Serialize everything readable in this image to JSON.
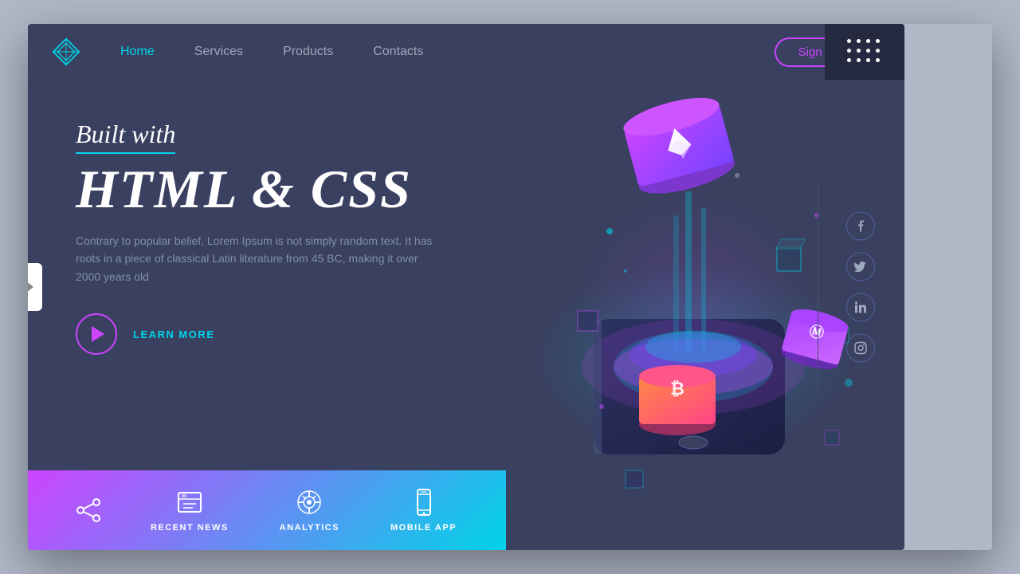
{
  "brand": {
    "logo_label": "logo-diamond"
  },
  "navbar": {
    "links": [
      {
        "label": "Home",
        "active": true
      },
      {
        "label": "Services",
        "active": false
      },
      {
        "label": "Products",
        "active": false
      },
      {
        "label": "Contacts",
        "active": false
      }
    ],
    "cta_label": "Sign Up"
  },
  "hero": {
    "subtitle": "Built with",
    "title": "HTML & CSS",
    "body": "Contrary to popular belief, Lorem Ipsum is not simply random text. It has roots in a piece of classical Latin literature from 45 BC, making it over 2000 years old",
    "cta_label": "LEARN MORE"
  },
  "bottom_bar": {
    "items": [
      {
        "label": "RECENT NEWS",
        "icon": "news-icon"
      },
      {
        "label": "ANALYTICS",
        "icon": "analytics-icon"
      },
      {
        "label": "MOBILE APP",
        "icon": "mobile-icon"
      }
    ]
  },
  "social": {
    "icons": [
      {
        "label": "facebook-icon",
        "symbol": "f"
      },
      {
        "label": "twitter-icon",
        "symbol": "t"
      },
      {
        "label": "linkedin-icon",
        "symbol": "in"
      },
      {
        "label": "instagram-icon",
        "symbol": "ig"
      }
    ]
  },
  "colors": {
    "accent_cyan": "#00d4e8",
    "accent_purple": "#cc44ff",
    "bg_dark": "#3a4060",
    "bg_darker": "#252a40"
  }
}
